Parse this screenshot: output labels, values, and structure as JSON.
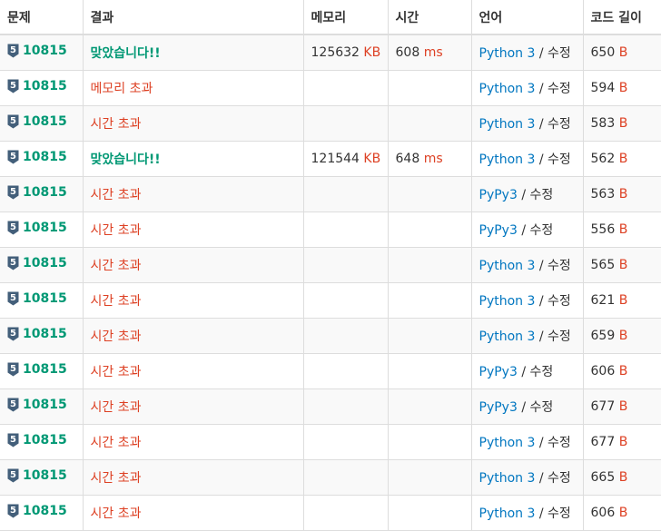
{
  "headers": {
    "problem": "문제",
    "result": "결과",
    "memory": "메모리",
    "time": "시간",
    "language": "언어",
    "code_length": "코드 길이"
  },
  "colors": {
    "accepted": "#009874",
    "failed": "#dd4124",
    "link": "#0076c0",
    "tier_badge": "#435f7a"
  },
  "tier_icon": "shield-tier-5-icon",
  "rows": [
    {
      "tier": "5",
      "problem": "10815",
      "result": "맞았습니다!!",
      "status": "ac",
      "memory": "125632",
      "memory_unit": "KB",
      "time": "608",
      "time_unit": "ms",
      "language": "Python 3",
      "slash": "/",
      "edit": "수정",
      "length": "650",
      "length_unit": "B"
    },
    {
      "tier": "5",
      "problem": "10815",
      "result": "메모리 초과",
      "status": "fail",
      "memory": "",
      "memory_unit": "",
      "time": "",
      "time_unit": "",
      "language": "Python 3",
      "slash": "/",
      "edit": "수정",
      "length": "594",
      "length_unit": "B"
    },
    {
      "tier": "5",
      "problem": "10815",
      "result": "시간 초과",
      "status": "fail",
      "memory": "",
      "memory_unit": "",
      "time": "",
      "time_unit": "",
      "language": "Python 3",
      "slash": "/",
      "edit": "수정",
      "length": "583",
      "length_unit": "B"
    },
    {
      "tier": "5",
      "problem": "10815",
      "result": "맞았습니다!!",
      "status": "ac",
      "memory": "121544",
      "memory_unit": "KB",
      "time": "648",
      "time_unit": "ms",
      "language": "Python 3",
      "slash": "/",
      "edit": "수정",
      "length": "562",
      "length_unit": "B"
    },
    {
      "tier": "5",
      "problem": "10815",
      "result": "시간 초과",
      "status": "fail",
      "memory": "",
      "memory_unit": "",
      "time": "",
      "time_unit": "",
      "language": "PyPy3",
      "slash": "/",
      "edit": "수정",
      "length": "563",
      "length_unit": "B"
    },
    {
      "tier": "5",
      "problem": "10815",
      "result": "시간 초과",
      "status": "fail",
      "memory": "",
      "memory_unit": "",
      "time": "",
      "time_unit": "",
      "language": "PyPy3",
      "slash": "/",
      "edit": "수정",
      "length": "556",
      "length_unit": "B"
    },
    {
      "tier": "5",
      "problem": "10815",
      "result": "시간 초과",
      "status": "fail",
      "memory": "",
      "memory_unit": "",
      "time": "",
      "time_unit": "",
      "language": "Python 3",
      "slash": "/",
      "edit": "수정",
      "length": "565",
      "length_unit": "B"
    },
    {
      "tier": "5",
      "problem": "10815",
      "result": "시간 초과",
      "status": "fail",
      "memory": "",
      "memory_unit": "",
      "time": "",
      "time_unit": "",
      "language": "Python 3",
      "slash": "/",
      "edit": "수정",
      "length": "621",
      "length_unit": "B"
    },
    {
      "tier": "5",
      "problem": "10815",
      "result": "시간 초과",
      "status": "fail",
      "memory": "",
      "memory_unit": "",
      "time": "",
      "time_unit": "",
      "language": "Python 3",
      "slash": "/",
      "edit": "수정",
      "length": "659",
      "length_unit": "B"
    },
    {
      "tier": "5",
      "problem": "10815",
      "result": "시간 초과",
      "status": "fail",
      "memory": "",
      "memory_unit": "",
      "time": "",
      "time_unit": "",
      "language": "PyPy3",
      "slash": "/",
      "edit": "수정",
      "length": "606",
      "length_unit": "B"
    },
    {
      "tier": "5",
      "problem": "10815",
      "result": "시간 초과",
      "status": "fail",
      "memory": "",
      "memory_unit": "",
      "time": "",
      "time_unit": "",
      "language": "PyPy3",
      "slash": "/",
      "edit": "수정",
      "length": "677",
      "length_unit": "B"
    },
    {
      "tier": "5",
      "problem": "10815",
      "result": "시간 초과",
      "status": "fail",
      "memory": "",
      "memory_unit": "",
      "time": "",
      "time_unit": "",
      "language": "Python 3",
      "slash": "/",
      "edit": "수정",
      "length": "677",
      "length_unit": "B"
    },
    {
      "tier": "5",
      "problem": "10815",
      "result": "시간 초과",
      "status": "fail",
      "memory": "",
      "memory_unit": "",
      "time": "",
      "time_unit": "",
      "language": "Python 3",
      "slash": "/",
      "edit": "수정",
      "length": "665",
      "length_unit": "B"
    },
    {
      "tier": "5",
      "problem": "10815",
      "result": "시간 초과",
      "status": "fail",
      "memory": "",
      "memory_unit": "",
      "time": "",
      "time_unit": "",
      "language": "Python 3",
      "slash": "/",
      "edit": "수정",
      "length": "606",
      "length_unit": "B"
    }
  ]
}
